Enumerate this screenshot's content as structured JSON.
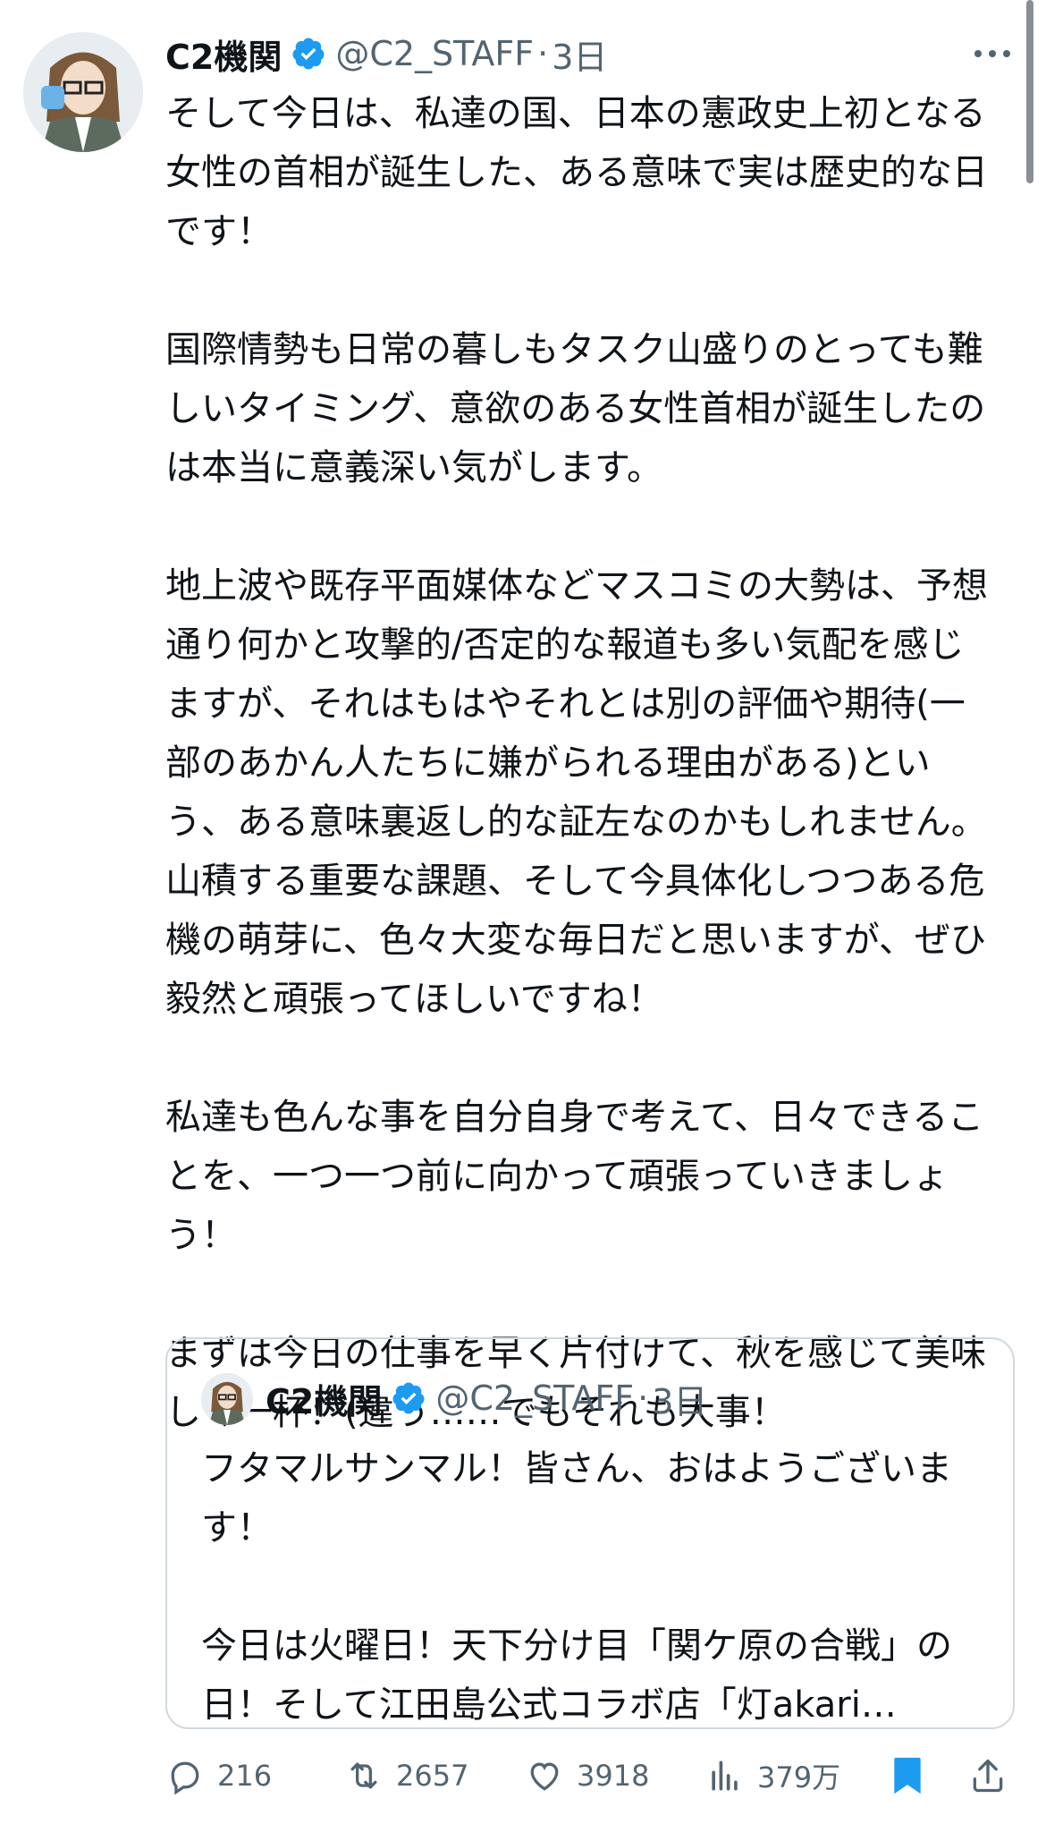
{
  "tweet": {
    "author_name": "C2機関",
    "handle": "@C2_STAFF",
    "separator": "·",
    "time": "3日",
    "text": "そして今日は、私達の国、日本の憲政史上初となる女性の首相が誕生した、ある意味で実は歴史的な日です！\n\n国際情勢も日常の暮しもタスク山盛りのとっても難しいタイミング、意欲のある女性首相が誕生したのは本当に意義深い気がします。\n\n地上波や既存平面媒体などマスコミの大勢は、予想通り何かと攻撃的/否定的な報道も多い気配を感じますが、それはもはやそれとは別の評価や期待(一部のあかん人たちに嫌がられる理由がある)という、ある意味裏返し的な証左なのかもしれません。\n山積する重要な課題、そして今具体化しつつある危機の萌芽に、色々大変な毎日だと思いますが、ぜひ毅然と頑張ってほしいですね！\n\n私達も色んな事を自分自身で考えて、日々できることを、一つ一つ前に向かって頑張っていきましょう！\n\nまずは今日の仕事を早く片付けて、秋を感じて美味しく一杯！(違う……でもそれも大事！"
  },
  "quoted": {
    "author_name": "C2機関",
    "handle": "@C2_STAFF",
    "separator": "·",
    "time": "3日",
    "text": "フタマルサンマル！皆さん、おはようございます！\n\n今日は火曜日！天下分け目「関ケ原の合戦」の日！そして江田島公式コラボ店「灯akari…"
  },
  "actions": {
    "replies": "216",
    "retweets": "2657",
    "likes": "3918",
    "views": "379万"
  },
  "colors": {
    "verified": "#1d9bf0",
    "bookmark_active": "#1d9bf0",
    "muted": "#536471"
  },
  "icons": [
    "verified-badge-icon",
    "more-icon",
    "reply-icon",
    "retweet-icon",
    "like-icon",
    "views-icon",
    "bookmark-icon",
    "share-icon"
  ]
}
